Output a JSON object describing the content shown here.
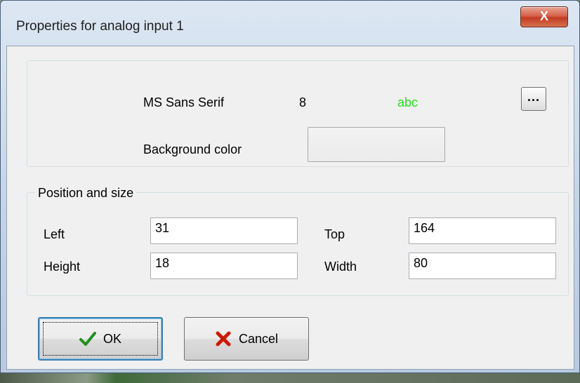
{
  "window": {
    "title": "Properties for analog input 1",
    "close_glyph": "X"
  },
  "font_section": {
    "font_name": "MS Sans Serif",
    "font_size": "8",
    "sample_text": "abc",
    "sample_color": "#22dd22",
    "browse_label": "...",
    "background_color_label": "Background color"
  },
  "position": {
    "legend": "Position and size",
    "left_label": "Left",
    "left_value": "31",
    "top_label": "Top",
    "top_value": "164",
    "height_label": "Height",
    "height_value": "18",
    "width_label": "Width",
    "width_value": "80"
  },
  "buttons": {
    "ok_label": "OK",
    "cancel_label": "Cancel"
  },
  "icons": {
    "ok_icon": "check-icon",
    "cancel_icon": "x-icon"
  }
}
